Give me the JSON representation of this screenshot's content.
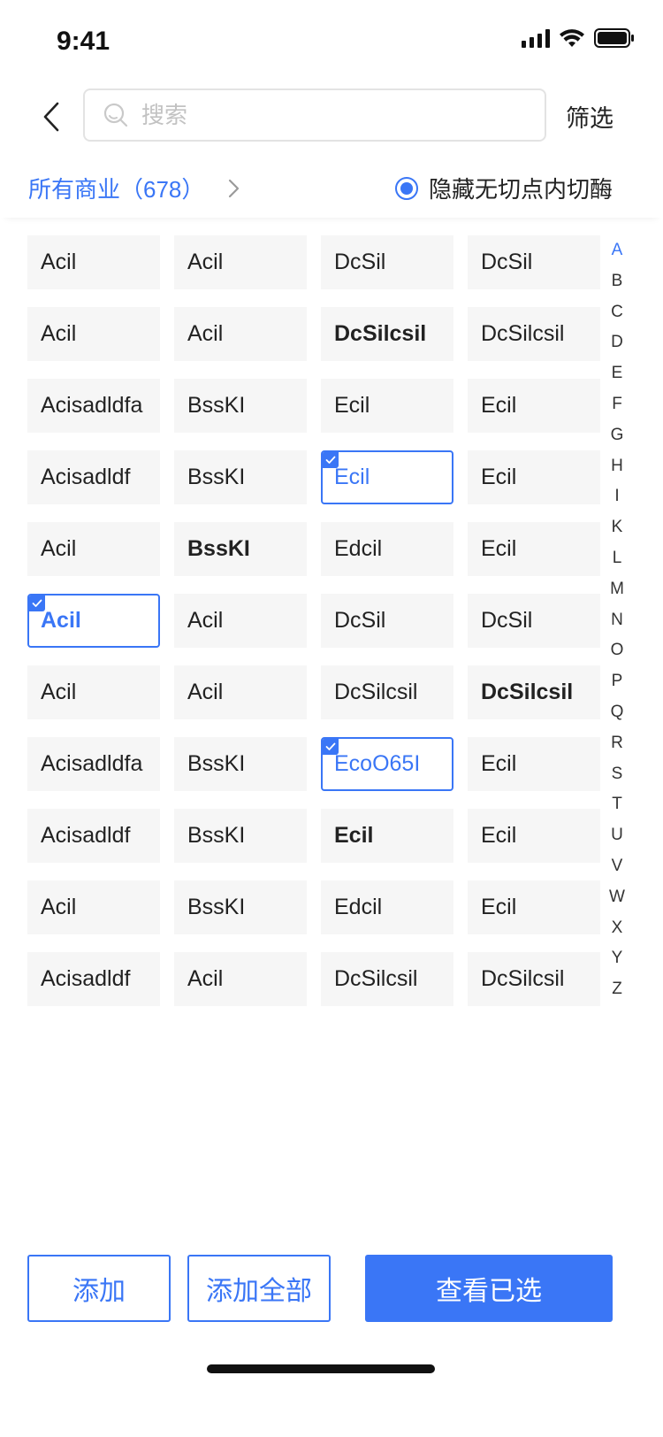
{
  "status_bar": {
    "time": "9:41",
    "icons": [
      "signal-icon",
      "wifi-icon",
      "battery-icon"
    ]
  },
  "header": {
    "back_icon": "chevron-left-icon",
    "search": {
      "placeholder": "搜索",
      "value": "",
      "icon": "search-icon"
    },
    "filter_label": "筛选"
  },
  "subheader": {
    "all_business": "所有商业（678）",
    "chevron_icon": "chevron-right-icon",
    "hide_toggle": {
      "label": "隐藏无切点内切酶",
      "checked": true
    }
  },
  "grid": {
    "cells": [
      {
        "text": "Acil",
        "bold": false,
        "selected": false
      },
      {
        "text": "Acil",
        "bold": false,
        "selected": false
      },
      {
        "text": "DcSil",
        "bold": false,
        "selected": false
      },
      {
        "text": "DcSil",
        "bold": false,
        "selected": false
      },
      {
        "text": "Acil",
        "bold": false,
        "selected": false
      },
      {
        "text": "Acil",
        "bold": false,
        "selected": false
      },
      {
        "text": "DcSilcsil",
        "bold": true,
        "selected": false
      },
      {
        "text": "DcSilcsil",
        "bold": false,
        "selected": false
      },
      {
        "text": "Acisadldfa",
        "bold": false,
        "selected": false
      },
      {
        "text": "BssKI",
        "bold": false,
        "selected": false
      },
      {
        "text": "Ecil",
        "bold": false,
        "selected": false
      },
      {
        "text": "Ecil",
        "bold": false,
        "selected": false
      },
      {
        "text": "Acisadldf",
        "bold": false,
        "selected": false
      },
      {
        "text": "BssKI",
        "bold": false,
        "selected": false
      },
      {
        "text": "Ecil",
        "bold": false,
        "selected": true
      },
      {
        "text": "Ecil",
        "bold": false,
        "selected": false
      },
      {
        "text": "Acil",
        "bold": false,
        "selected": false
      },
      {
        "text": "BssKI",
        "bold": true,
        "selected": false
      },
      {
        "text": "Edcil",
        "bold": false,
        "selected": false
      },
      {
        "text": "Ecil",
        "bold": false,
        "selected": false
      },
      {
        "text": "Acil",
        "bold": true,
        "selected": true
      },
      {
        "text": "Acil",
        "bold": false,
        "selected": false
      },
      {
        "text": "DcSil",
        "bold": false,
        "selected": false
      },
      {
        "text": "DcSil",
        "bold": false,
        "selected": false
      },
      {
        "text": "Acil",
        "bold": false,
        "selected": false
      },
      {
        "text": "Acil",
        "bold": false,
        "selected": false
      },
      {
        "text": "DcSilcsil",
        "bold": false,
        "selected": false
      },
      {
        "text": "DcSilcsil",
        "bold": true,
        "selected": false
      },
      {
        "text": "Acisadldfa",
        "bold": false,
        "selected": false
      },
      {
        "text": "BssKI",
        "bold": false,
        "selected": false
      },
      {
        "text": "EcoO65I",
        "bold": false,
        "selected": true
      },
      {
        "text": "Ecil",
        "bold": false,
        "selected": false
      },
      {
        "text": "Acisadldf",
        "bold": false,
        "selected": false
      },
      {
        "text": "BssKI",
        "bold": false,
        "selected": false
      },
      {
        "text": "Ecil",
        "bold": true,
        "selected": false
      },
      {
        "text": "Ecil",
        "bold": false,
        "selected": false
      },
      {
        "text": "Acil",
        "bold": false,
        "selected": false
      },
      {
        "text": "BssKI",
        "bold": false,
        "selected": false
      },
      {
        "text": "Edcil",
        "bold": false,
        "selected": false
      },
      {
        "text": "Ecil",
        "bold": false,
        "selected": false
      },
      {
        "text": "Acisadldf",
        "bold": false,
        "selected": false
      },
      {
        "text": "Acil",
        "bold": false,
        "selected": false
      },
      {
        "text": "DcSilcsil",
        "bold": false,
        "selected": false
      },
      {
        "text": "DcSilcsil",
        "bold": false,
        "selected": false
      }
    ]
  },
  "alphabet": {
    "letters": [
      "A",
      "B",
      "C",
      "D",
      "E",
      "F",
      "G",
      "H",
      "I",
      "K",
      "L",
      "M",
      "N",
      "O",
      "P",
      "Q",
      "R",
      "S",
      "T",
      "U",
      "V",
      "W",
      "X",
      "Y",
      "Z"
    ],
    "active": "A"
  },
  "footer": {
    "add_label": "添加",
    "add_all_label": "添加全部",
    "view_selected_label": "查看已选"
  },
  "colors": {
    "accent": "#3a76f6",
    "cell_background": "#f6f6f6",
    "text": "#222222",
    "placeholder": "#c2c2c2"
  }
}
